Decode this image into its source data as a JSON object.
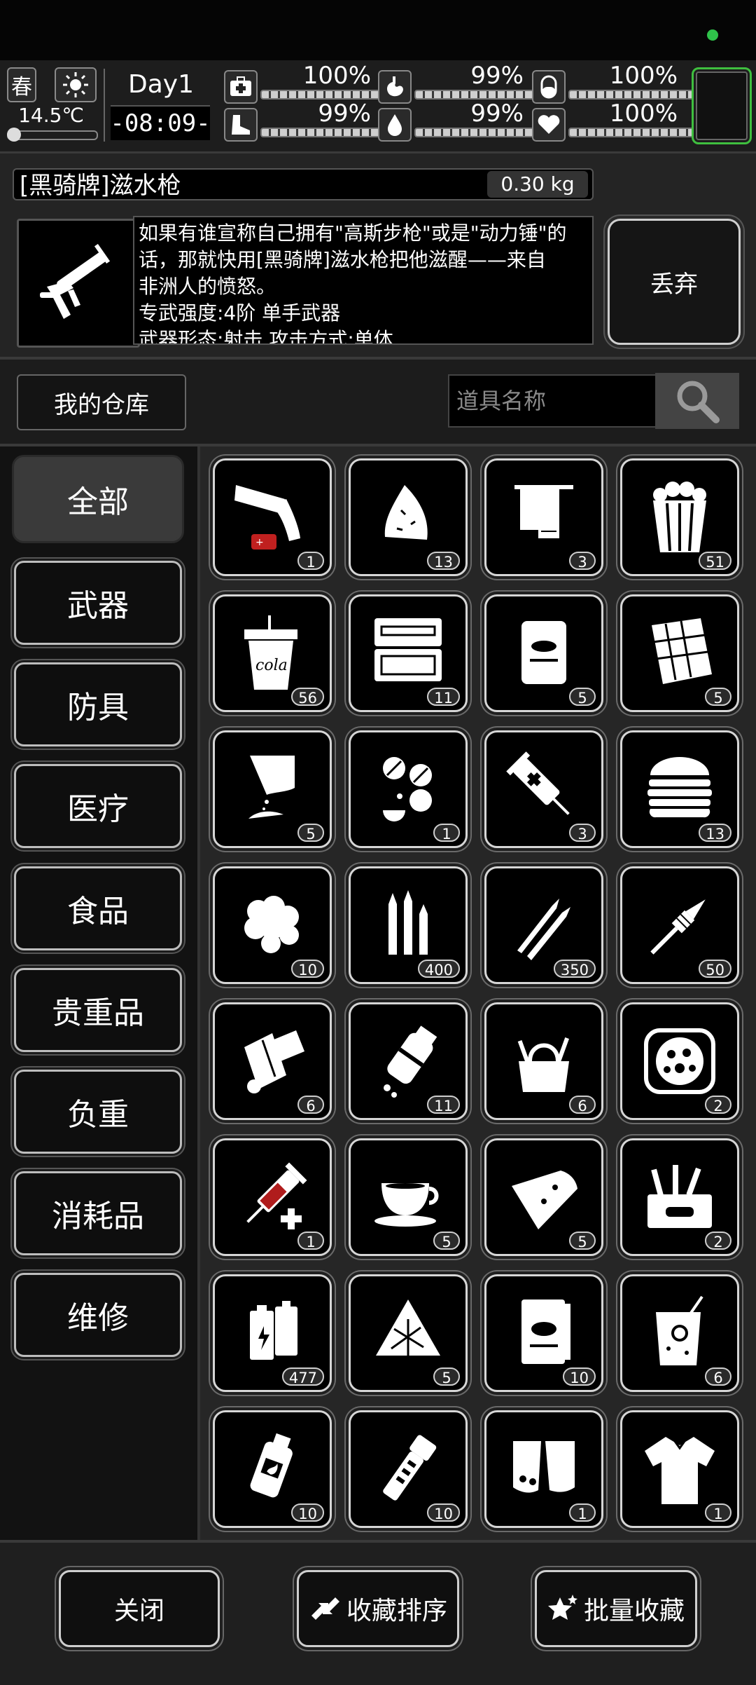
{
  "status": {
    "season": "春",
    "temperature": "14.5℃",
    "day": "Day1",
    "time": "-08:09-",
    "stats": [
      {
        "name": "health",
        "icon": "medkit-icon",
        "value": "100%"
      },
      {
        "name": "stomach",
        "icon": "stomach-icon",
        "value": "99%"
      },
      {
        "name": "stamina",
        "icon": "capsule-icon",
        "value": "100%"
      },
      {
        "name": "legs",
        "icon": "foot-icon",
        "value": "99%"
      },
      {
        "name": "water",
        "icon": "water-drop-icon",
        "value": "99%"
      },
      {
        "name": "mood",
        "icon": "heart-icon",
        "value": "100%"
      }
    ]
  },
  "detail": {
    "item_name": "[黑骑牌]滋水枪",
    "weight": "0.30 kg",
    "description_lines": [
      "如果有谁宣称自己拥有\"高斯步枪\"或是\"动力锤\"的",
      "话，那就快用[黑骑牌]滋水枪把他滋醒——来自",
      "非洲人的愤怒。",
      "专武强度:4阶 单手武器",
      "武器形态:射击 攻击方式:单体"
    ],
    "discard_label": "丢弃"
  },
  "warehouse": {
    "title": "我的仓库",
    "search_placeholder": "道具名称"
  },
  "categories": [
    "全部",
    "武器",
    "防具",
    "医疗",
    "食品",
    "贵重品",
    "负重",
    "消耗品",
    "维修"
  ],
  "items": [
    {
      "icon": "flare-gun-icon",
      "count": "1"
    },
    {
      "icon": "rag-icon",
      "count": "13"
    },
    {
      "icon": "towel-icon",
      "count": "3"
    },
    {
      "icon": "popcorn-icon",
      "count": "51"
    },
    {
      "icon": "cola-cup-icon",
      "count": "56"
    },
    {
      "icon": "toolkit-case-icon",
      "count": "11"
    },
    {
      "icon": "canned-food-icon",
      "count": "5"
    },
    {
      "icon": "chocolate-bar-icon",
      "count": "5"
    },
    {
      "icon": "powder-packet-icon",
      "count": "5"
    },
    {
      "icon": "pills-icon",
      "count": "1"
    },
    {
      "icon": "syringe-icon",
      "count": "3"
    },
    {
      "icon": "burger-icon",
      "count": "13"
    },
    {
      "icon": "cotton-icon",
      "count": "10"
    },
    {
      "icon": "rifle-ammo-icon",
      "count": "400"
    },
    {
      "icon": "bullets-icon",
      "count": "350"
    },
    {
      "icon": "rocket-icon",
      "count": "50"
    },
    {
      "icon": "bandage-icon",
      "count": "6"
    },
    {
      "icon": "pill-bottle-icon",
      "count": "11"
    },
    {
      "icon": "tool-bag-icon",
      "count": "6"
    },
    {
      "icon": "pizza-tray-icon",
      "count": "2"
    },
    {
      "icon": "blood-syringe-icon",
      "count": "1"
    },
    {
      "icon": "coffee-cup-icon",
      "count": "5"
    },
    {
      "icon": "pie-slice-icon",
      "count": "5"
    },
    {
      "icon": "toolbox-icon",
      "count": "2"
    },
    {
      "icon": "battery-icon",
      "count": "477"
    },
    {
      "icon": "rice-dumpling-icon",
      "count": "5"
    },
    {
      "icon": "book-icon",
      "count": "10"
    },
    {
      "icon": "juice-glass-icon",
      "count": "6"
    },
    {
      "icon": "fire-extinguisher-icon",
      "count": "10"
    },
    {
      "icon": "flashlight-icon",
      "count": "10"
    },
    {
      "icon": "gloves-icon",
      "count": "1"
    },
    {
      "icon": "shirt-icon",
      "count": "1"
    }
  ],
  "bottom_buttons": {
    "close": "关闭",
    "sort": "收藏排序",
    "batch": "批量收藏"
  }
}
